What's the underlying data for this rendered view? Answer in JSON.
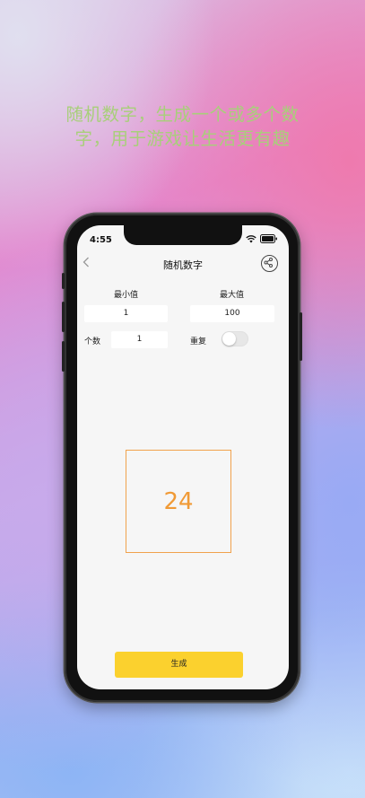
{
  "headline": "随机数字，生成一个或多个数字，用于游戏让生活更有趣",
  "status": {
    "time": "4:55"
  },
  "nav": {
    "title": "随机数字",
    "back_icon": "chevron-left-icon",
    "share_icon": "share-icon"
  },
  "form": {
    "min_label": "最小值",
    "min_value": "1",
    "max_label": "最大值",
    "max_value": "100",
    "count_label": "个数",
    "count_value": "1",
    "repeat_label": "重复",
    "repeat_on": false
  },
  "result": {
    "value": "24"
  },
  "generate_label": "生成",
  "colors": {
    "accent": "#fbd12e",
    "result": "#f09a36",
    "headline": "#a8cf7a"
  }
}
